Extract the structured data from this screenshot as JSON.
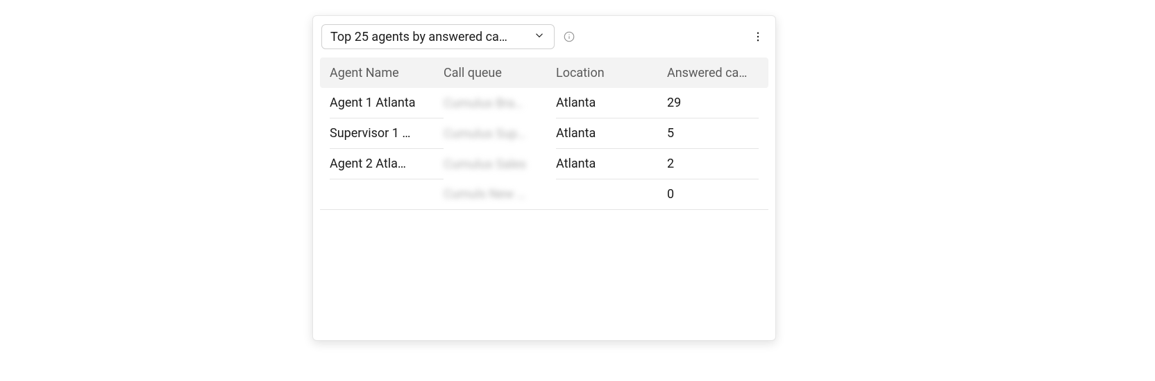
{
  "dropdown": {
    "label": "Top 25 agents by answered ca…"
  },
  "table": {
    "headers": {
      "agent": "Agent Name",
      "queue": "Call queue",
      "location": "Location",
      "answered": "Answered ca…"
    },
    "rows": [
      {
        "agent": "Agent 1 Atlanta",
        "queue": "Cumulus Bra…",
        "location": "Atlanta",
        "answered": "29"
      },
      {
        "agent": "Supervisor 1 …",
        "queue": "Cumulus Sup…",
        "location": "Atlanta",
        "answered": "5"
      },
      {
        "agent": "Agent 2 Atla…",
        "queue": "Cumulus Sales",
        "location": "Atlanta",
        "answered": "2"
      },
      {
        "agent": "",
        "queue": "Cumuls New …",
        "location": "",
        "answered": "0"
      }
    ]
  }
}
